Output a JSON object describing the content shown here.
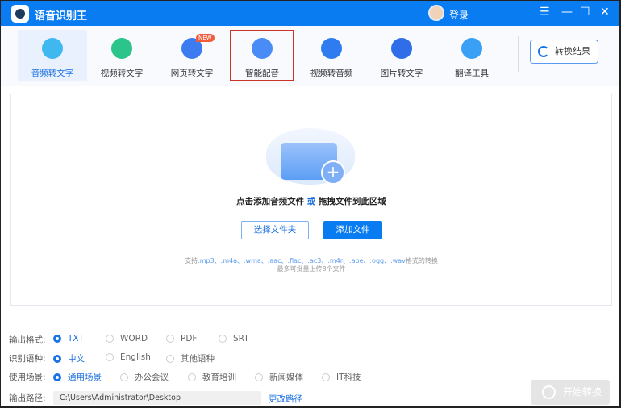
{
  "app": {
    "title": "语音识别王",
    "login": "登录",
    "window_controls": [
      "☰",
      "—",
      "☐",
      "✕"
    ]
  },
  "tabs": [
    {
      "label": "音频转文字",
      "icon": "audio-to-text-icon",
      "color": "#3fb8f0",
      "active": true
    },
    {
      "label": "视频转文字",
      "icon": "video-to-text-icon",
      "color": "#2bc48a"
    },
    {
      "label": "网页转文字",
      "icon": "web-to-text-icon",
      "color": "#3d7cf0",
      "badge": "NEW"
    },
    {
      "label": "智能配音",
      "icon": "dubbing-icon",
      "color": "#4a8cf5"
    },
    {
      "label": "视频转音频",
      "icon": "video-to-audio-icon",
      "color": "#2f7cf0"
    },
    {
      "label": "图片转文字",
      "icon": "image-to-text-icon",
      "color": "#2f6ee8"
    },
    {
      "label": "翻译工具",
      "icon": "translate-icon",
      "color": "#3aa0f5"
    }
  ],
  "result_button": "转换结果",
  "drop": {
    "hint_a": "点击添加音频文件",
    "hint_or": "或",
    "hint_b": "拖拽文件到此区域",
    "select_folder": "选择文件夹",
    "add_file": "添加文件",
    "support_pre": "支持",
    "support_formats": ".mp3、.m4a、.wma、.aac、.flac、.ac3、.m4r、.ape、.ogg、.wav",
    "support_post": "格式的转换",
    "limit": "最多可批量上传8个文件"
  },
  "options": {
    "format": {
      "label": "输出格式:",
      "items": [
        "TXT",
        "WORD",
        "PDF",
        "SRT"
      ],
      "selected": "TXT"
    },
    "language": {
      "label": "识别语种:",
      "items": [
        "中文",
        "English",
        "其他语种"
      ],
      "selected": "中文"
    },
    "scene": {
      "label": "使用场景:",
      "items": [
        "通用场景",
        "办公会议",
        "教育培训",
        "新闻媒体",
        "IT科技"
      ],
      "selected": "通用场景"
    },
    "path": {
      "label": "输出路径:",
      "value": "C:\\Users\\Administrator\\Desktop",
      "change": "更改路径"
    }
  },
  "start_button": "开始转换"
}
